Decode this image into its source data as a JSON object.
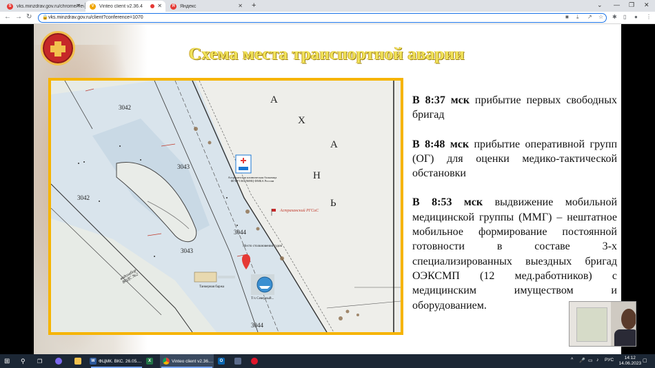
{
  "browser": {
    "tabs": [
      {
        "title": "vks.minzdrav.gov.ru/chrome/?ev",
        "favicon_color": "#e53935",
        "favicon_letter": "S"
      },
      {
        "title": "Vinteo client v2.36.4",
        "favicon_color": "#f0a500",
        "favicon_letter": "V",
        "active": true
      },
      {
        "title": "Яндекс",
        "favicon_color": "#e53935",
        "favicon_letter": "Я"
      }
    ],
    "url": "vks.minzdrav.gov.ru/client?conference=1070"
  },
  "slide": {
    "title": "Схема места транспортной аварии",
    "paragraphs": [
      {
        "time": "В 8:37 мск",
        "text": " прибытие первых свободных бригад"
      },
      {
        "time": "В 8:48 мск",
        "text": " прибытие оперативной групп (ОГ) для оценки медико-тактической обстановки"
      },
      {
        "time": "В 8:53 мск",
        "text": " выдвижение мобильной медицинской группы (ММГ) – нештатное мобильное формирование постоянной готовности в составе 3-х специализированных выездных бригад ОЭКСМП (12 мед.работников) с медицинским имуществом и оборудованием."
      }
    ],
    "map_labels": {
      "hospital": "Астраханская клиническая больница ФГБУЗ ЮОМНЦ ФМБА России",
      "accident": "Место столкновения судов",
      "rescue": "Астраханский РГСиС",
      "tanker": "Танкерная баржа",
      "ship": "Т/х Северный...",
      "depths": [
        "3042",
        "3043",
        "3042",
        "3044",
        "3043",
        "3044"
      ],
      "river_letters": [
        "А",
        "Х",
        "А",
        "Н",
        "Ь"
      ],
      "vodozabor": "водозабор ВОДС №2"
    }
  },
  "taskbar": {
    "apps": [
      {
        "label": "ФЦМК. ВКС. 26.05....",
        "color": "#2b579a",
        "letter": "W"
      },
      {
        "label": "",
        "color": "#217346",
        "letter": "X"
      },
      {
        "label": "Vinteo client v2.36....",
        "color": "#4285f4",
        "letter": "",
        "active": true
      },
      {
        "label": "",
        "color": "#0a64ad",
        "letter": "O"
      }
    ],
    "lang": "РУС",
    "time": "14:12",
    "date": "14.06.2023"
  }
}
